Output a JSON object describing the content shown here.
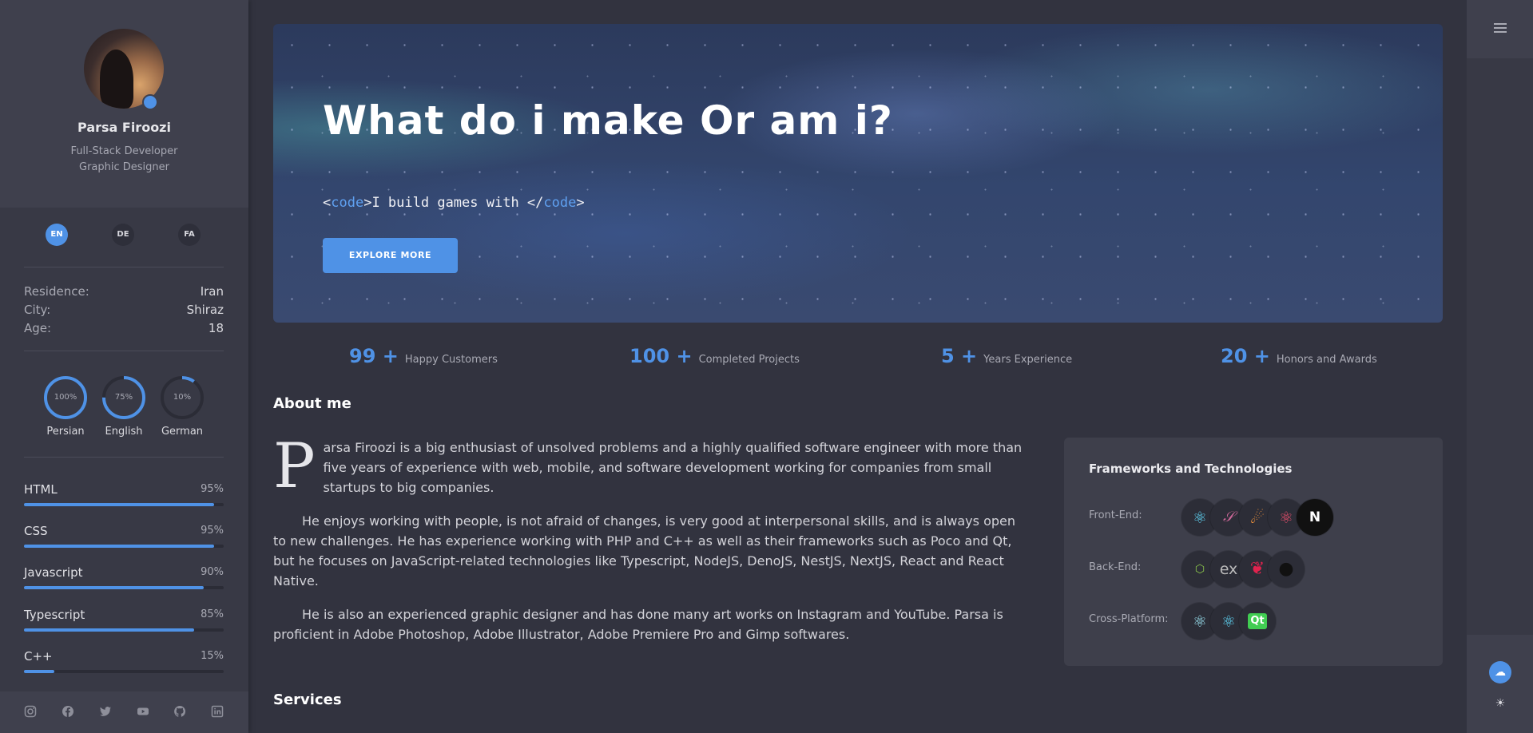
{
  "profile": {
    "name": "Parsa Firoozi",
    "role1": "Full-Stack Developer",
    "role2": "Graphic Designer"
  },
  "languages_switch": [
    {
      "code": "EN",
      "active": true
    },
    {
      "code": "DE",
      "active": false
    },
    {
      "code": "FA",
      "active": false
    }
  ],
  "info": [
    {
      "label": "Residence:",
      "value": "Iran"
    },
    {
      "label": "City:",
      "value": "Shiraz"
    },
    {
      "label": "Age:",
      "value": "18"
    }
  ],
  "spoken_languages": [
    {
      "name": "Persian",
      "percent_label": "100%",
      "level": 1.0
    },
    {
      "name": "English",
      "percent_label": "75%",
      "level": 0.75
    },
    {
      "name": "German",
      "percent_label": "10%",
      "level": 0.1
    }
  ],
  "skills": [
    {
      "name": "HTML",
      "percent_label": "95%",
      "level": 0.95
    },
    {
      "name": "CSS",
      "percent_label": "95%",
      "level": 0.95
    },
    {
      "name": "Javascript",
      "percent_label": "90%",
      "level": 0.9
    },
    {
      "name": "Typescript",
      "percent_label": "85%",
      "level": 0.85
    },
    {
      "name": "C++",
      "percent_label": "15%",
      "level": 0.15
    }
  ],
  "socials": [
    "instagram-icon",
    "facebook-icon",
    "twitter-icon",
    "youtube-icon",
    "github-icon",
    "linkedin-icon"
  ],
  "hero": {
    "title": "What do i make Or am i?",
    "code_open_lt": "<",
    "code_open_kw": "code",
    "code_open_gt": ">",
    "code_text": "I build games with ",
    "code_close_lt": "</",
    "code_close_kw": "code",
    "code_close_gt": ">",
    "button": "EXPLORE MORE"
  },
  "stats": [
    {
      "number": "99 +",
      "label": "Happy Customers"
    },
    {
      "number": "100 +",
      "label": "Completed Projects"
    },
    {
      "number": "5 +",
      "label": "Years Experience"
    },
    {
      "number": "20 +",
      "label": "Honors and Awards"
    }
  ],
  "about": {
    "heading": "About me",
    "dropcap": "P",
    "p1": "arsa Firoozi is a big enthusiast of unsolved problems and a highly qualified software engineer with more than five years of experience with web, mobile, and software development working for companies from small startups to big companies.",
    "p2": "He enjoys working with people, is not afraid of changes, is very good at interpersonal skills, and is always open to new challenges. He has experience working with PHP and C++ as well as their frameworks such as Poco and Qt, but he focuses on JavaScript-related technologies like Typescript, NodeJS, DenoJS, NestJS, NextJS, React and React Native.",
    "p3": "He is also an experienced graphic designer and has done many art works on Instagram and YouTube. Parsa is proficient in Adobe Photoshop, Adobe Illustrator, Adobe Premiere Pro and Gimp softwares."
  },
  "frameworks": {
    "title": "Frameworks and Technologies",
    "rows": [
      {
        "label": "Front-End:",
        "icons": [
          "react-icon",
          "sass-icon",
          "astro-icon",
          "redux-icon",
          "nextjs-icon"
        ]
      },
      {
        "label": "Back-End:",
        "icons": [
          "nodejs-icon",
          "express-icon",
          "nestjs-icon",
          "deno-icon"
        ]
      },
      {
        "label": "Cross-Platform:",
        "icons": [
          "electron-icon",
          "react-native-icon",
          "qt-icon"
        ]
      }
    ]
  },
  "services": {
    "heading": "Services"
  },
  "colors": {
    "accent": "#4f92e6",
    "background": "#32333f",
    "sidebar": "#383945"
  }
}
